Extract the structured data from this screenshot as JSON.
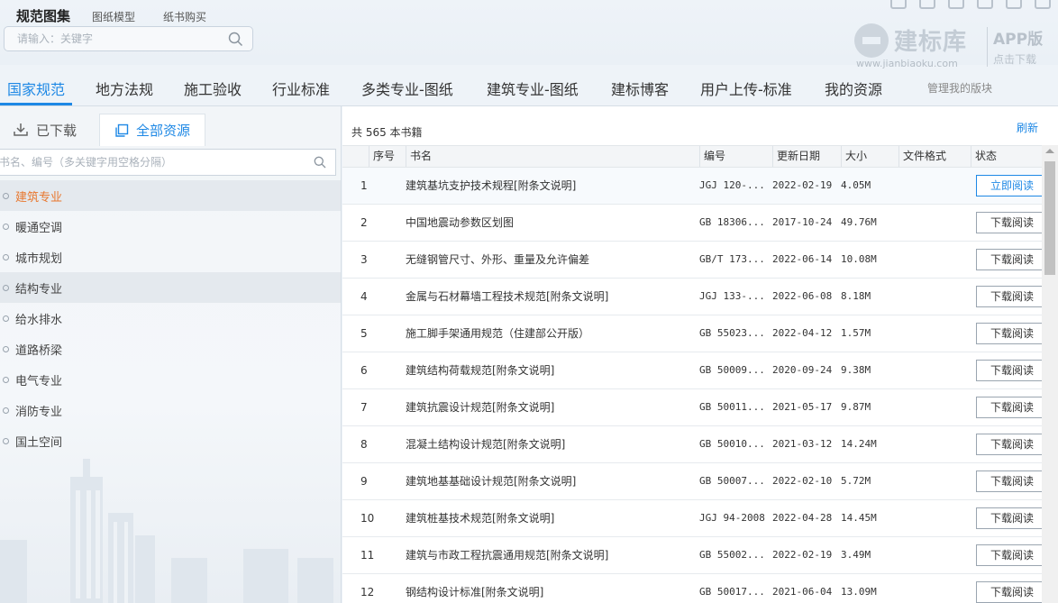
{
  "header": {
    "tabs": [
      {
        "label": "规范图集",
        "active": true
      },
      {
        "label": "图纸模型",
        "active": false
      },
      {
        "label": "纸书购买",
        "active": false
      }
    ],
    "search_placeholder": "请输入：关键字"
  },
  "brand": {
    "name": "建标库",
    "url": "www.jianbiaoku.com",
    "app_label": "APP版",
    "download_label": "点击下载"
  },
  "nav": {
    "items": [
      {
        "label": "国家规范",
        "active": true
      },
      {
        "label": "地方法规"
      },
      {
        "label": "施工验收"
      },
      {
        "label": "行业标准"
      },
      {
        "label": "多类专业-图纸"
      },
      {
        "label": "建筑专业-图纸"
      },
      {
        "label": "建标博客"
      },
      {
        "label": "用户上传-标准"
      },
      {
        "label": "我的资源"
      },
      {
        "label": "管理我的版块"
      }
    ],
    "accent": "#1e88e5"
  },
  "left": {
    "tabs": {
      "downloaded": "已下载",
      "all": "全部资源"
    },
    "filter_placeholder": "书名、编号（多关键字用空格分隔）",
    "categories": [
      {
        "label": "建筑专业",
        "active": true
      },
      {
        "label": "暖通空调"
      },
      {
        "label": "城市规划"
      },
      {
        "label": "结构专业"
      },
      {
        "label": "给水排水"
      },
      {
        "label": "道路桥梁"
      },
      {
        "label": "电气专业"
      },
      {
        "label": "消防专业"
      },
      {
        "label": "国土空间"
      }
    ]
  },
  "main": {
    "count_text": "共 565 本书籍",
    "refresh_label": "刷新",
    "columns": {
      "idx": "序号",
      "name": "书名",
      "code": "编号",
      "date": "更新日期",
      "size": "大小",
      "format": "文件格式",
      "status": "状态"
    },
    "rows": [
      {
        "idx": "1",
        "name": "建筑基坑支护技术规程[附条文说明]",
        "code": "JGJ 120-...",
        "date": "2022-02-19",
        "size": "4.05M",
        "action": "立即阅读"
      },
      {
        "idx": "2",
        "name": "中国地震动参数区划图",
        "code": "GB 18306...",
        "date": "2017-10-24",
        "size": "49.76M",
        "action": "下载阅读"
      },
      {
        "idx": "3",
        "name": "无缝钢管尺寸、外形、重量及允许偏差",
        "code": "GB/T 173...",
        "date": "2022-06-14",
        "size": "10.08M",
        "action": "下载阅读"
      },
      {
        "idx": "4",
        "name": "金属与石材幕墙工程技术规范[附条文说明]",
        "code": "JGJ 133-...",
        "date": "2022-06-08",
        "size": "8.18M",
        "action": "下载阅读"
      },
      {
        "idx": "5",
        "name": "施工脚手架通用规范（住建部公开版）",
        "code": "GB 55023...",
        "date": "2022-04-12",
        "size": "1.57M",
        "action": "下载阅读"
      },
      {
        "idx": "6",
        "name": "建筑结构荷载规范[附条文说明]",
        "code": "GB 50009...",
        "date": "2020-09-24",
        "size": "9.38M",
        "action": "下载阅读"
      },
      {
        "idx": "7",
        "name": "建筑抗震设计规范[附条文说明]",
        "code": "GB 50011...",
        "date": "2021-05-17",
        "size": "9.87M",
        "action": "下载阅读"
      },
      {
        "idx": "8",
        "name": "混凝土结构设计规范[附条文说明]",
        "code": "GB 50010...",
        "date": "2021-03-12",
        "size": "14.24M",
        "action": "下载阅读"
      },
      {
        "idx": "9",
        "name": "建筑地基基础设计规范[附条文说明]",
        "code": "GB 50007...",
        "date": "2022-02-10",
        "size": "5.72M",
        "action": "下载阅读"
      },
      {
        "idx": "10",
        "name": "建筑桩基技术规范[附条文说明]",
        "code": "JGJ 94-2008",
        "date": "2022-04-28",
        "size": "14.45M",
        "action": "下载阅读"
      },
      {
        "idx": "11",
        "name": "建筑与市政工程抗震通用规范[附条文说明]",
        "code": "GB 55002...",
        "date": "2022-02-19",
        "size": "3.49M",
        "action": "下载阅读"
      },
      {
        "idx": "12",
        "name": "钢结构设计标准[附条文说明]",
        "code": "GB 50017...",
        "date": "2021-06-04",
        "size": "13.09M",
        "action": "下载阅读"
      }
    ]
  }
}
